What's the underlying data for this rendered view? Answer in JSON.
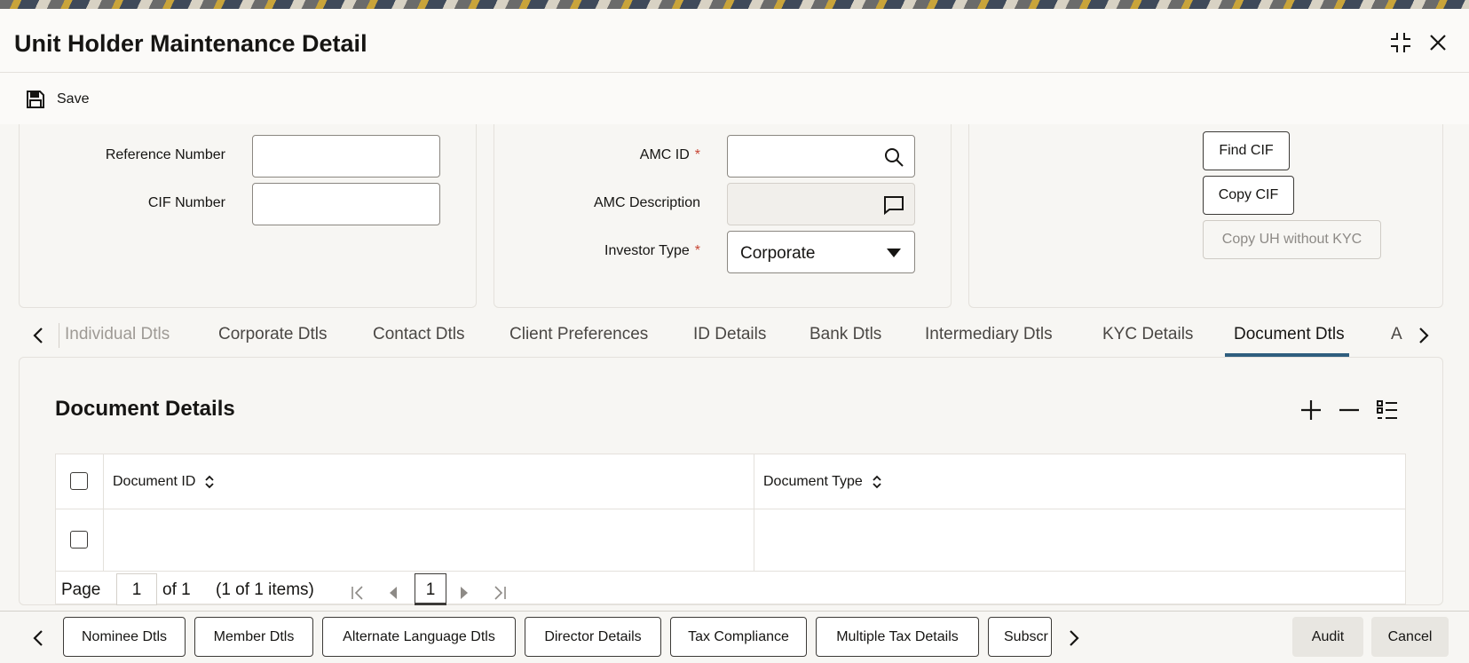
{
  "window": {
    "title": "Unit Holder Maintenance Detail"
  },
  "toolbar": {
    "save_label": "Save"
  },
  "form": {
    "reference_number_label": "Reference Number",
    "reference_number_value": "",
    "cif_number_label": "CIF Number",
    "cif_number_value": "",
    "amc_id_label": "AMC ID",
    "amc_id_value": "",
    "amc_description_label": "AMC Description",
    "amc_description_value": "",
    "investor_type_label": "Investor Type",
    "investor_type_value": "Corporate",
    "required_mark": "*"
  },
  "actions": {
    "find_cif": "Find CIF",
    "copy_cif": "Copy CIF",
    "copy_uh_without_kyc": "Copy UH without KYC"
  },
  "tabs": [
    {
      "label": "Individual Dtls",
      "state": "disabled"
    },
    {
      "label": "Corporate Dtls",
      "state": "normal"
    },
    {
      "label": "Contact Dtls",
      "state": "normal"
    },
    {
      "label": "Client Preferences",
      "state": "normal"
    },
    {
      "label": "ID Details",
      "state": "normal"
    },
    {
      "label": "Bank Dtls",
      "state": "normal"
    },
    {
      "label": "Intermediary Dtls",
      "state": "normal"
    },
    {
      "label": "KYC Details",
      "state": "normal"
    },
    {
      "label": "Document Dtls",
      "state": "active"
    },
    {
      "label": "A",
      "state": "normal"
    }
  ],
  "document_details": {
    "title": "Document Details",
    "columns": [
      "Document ID",
      "Document Type"
    ],
    "rows": [
      {
        "document_id": "",
        "document_type": ""
      }
    ]
  },
  "pager": {
    "page_label": "Page",
    "page_value": "1",
    "of_label": "of 1",
    "items_label": "(1 of 1 items)",
    "current_page": "1"
  },
  "footer": {
    "buttons": [
      "Nominee Dtls",
      "Member Dtls",
      "Alternate Language Dtls",
      "Director Details",
      "Tax Compliance",
      "Multiple Tax Details",
      "Subscr"
    ],
    "audit": "Audit",
    "cancel": "Cancel"
  },
  "colors": {
    "accent": "#2f5e7e",
    "required": "#c74634",
    "text": "#161513",
    "border": "#e4e1dc"
  }
}
